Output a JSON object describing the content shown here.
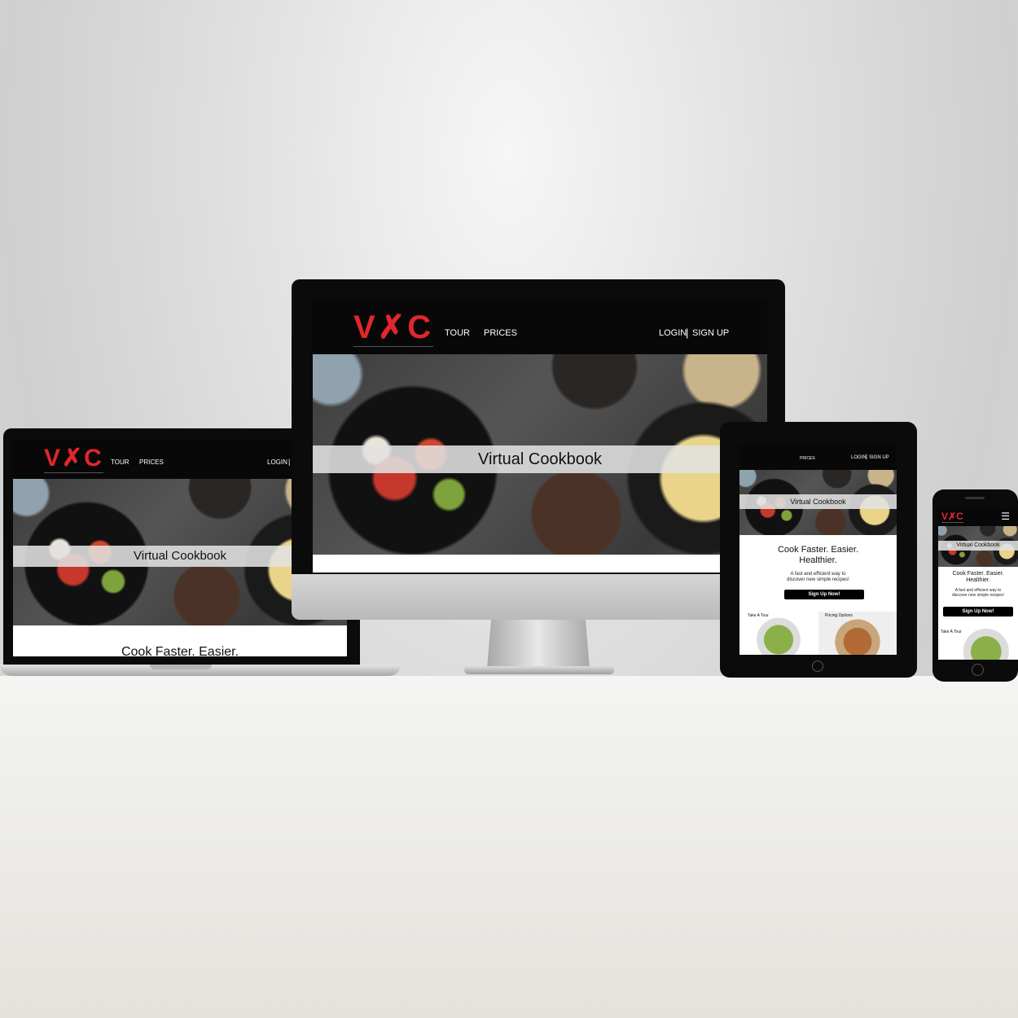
{
  "brand": {
    "logo": "VYC",
    "accent": "#e1262d"
  },
  "nav": {
    "tour": "TOUR",
    "prices": "PRICES",
    "login": "LOGIN",
    "separator": "|",
    "signup": "SIGN UP"
  },
  "hero": {
    "title": "Virtual Cookbook"
  },
  "content": {
    "tagline_partial": "Cook Faster. Easier.",
    "tagline_line1": "Cook Faster. Easier.",
    "tagline_line2": "Healthier.",
    "desc_line1": "A fast and efficient way to",
    "desc_line2": "discover new simple recipes!",
    "signup_button": "Sign Up Now!",
    "take_tour": "Take A Tour",
    "pricing_options": "Pricing Options"
  },
  "icons": {
    "menu": "hamburger-menu-icon",
    "logo_mark": "fork-knife-icon"
  }
}
